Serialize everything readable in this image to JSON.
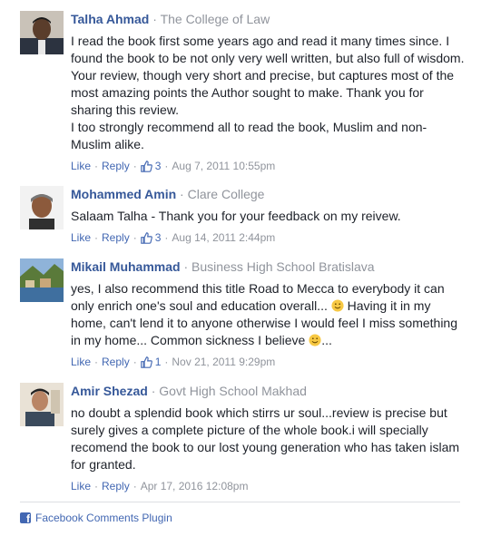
{
  "comments": [
    {
      "author": "Talha Ahmad",
      "affiliation": "The College of Law",
      "text_lines": [
        "I read the book first some years ago and read it many times since. I found the book to be not only very well written, but also full of wisdom. Your review, though very short and precise, but captures most of the most amazing points the Author sought to make. Thank you for sharing this review.",
        "I too strongly recommend all to read the book, Muslim and non-Muslim alike."
      ],
      "like_label": "Like",
      "reply_label": "Reply",
      "like_count": "3",
      "timestamp": "Aug 7, 2011 10:55pm"
    },
    {
      "author": "Mohammed Amin",
      "affiliation": "Clare College",
      "text_lines": [
        "Salaam Talha - Thank you for your feedback on my reivew."
      ],
      "like_label": "Like",
      "reply_label": "Reply",
      "like_count": "3",
      "timestamp": "Aug 14, 2011 2:44pm"
    },
    {
      "author": "Mikail Muhammad",
      "affiliation": "Business High School Bratislava",
      "text_before_emoji": "yes, I also recommend this title Road to Mecca to everybody it can only enrich one's soul and education overall...",
      "text_between_emoji": "Having it in my home, can't lend it to anyone otherwise I would feel I miss something in my home... Common sickness I believe",
      "text_after_emoji": "...",
      "like_label": "Like",
      "reply_label": "Reply",
      "like_count": "1",
      "timestamp": "Nov 21, 2011 9:29pm"
    },
    {
      "author": "Amir Shezad",
      "affiliation": "Govt High School Makhad",
      "text_lines": [
        "no doubt a splendid book which stirrs ur soul...review is precise but surely gives a complete picture of the whole book.i will specially recomend the book to our lost young generation who has taken islam for granted."
      ],
      "like_label": "Like",
      "reply_label": "Reply",
      "timestamp": "Apr 17, 2016 12:08pm"
    }
  ],
  "separator": "·",
  "footer": {
    "label": "Facebook Comments Plugin"
  },
  "icons": {
    "like": "thumbs-up-icon",
    "emoji": "smiley-emoji-icon",
    "logo": "facebook-logo-icon"
  },
  "colors": {
    "link": "#4267b2",
    "author": "#365899",
    "meta": "#90949c",
    "text": "#1d2129",
    "divider": "#dddfe2"
  }
}
